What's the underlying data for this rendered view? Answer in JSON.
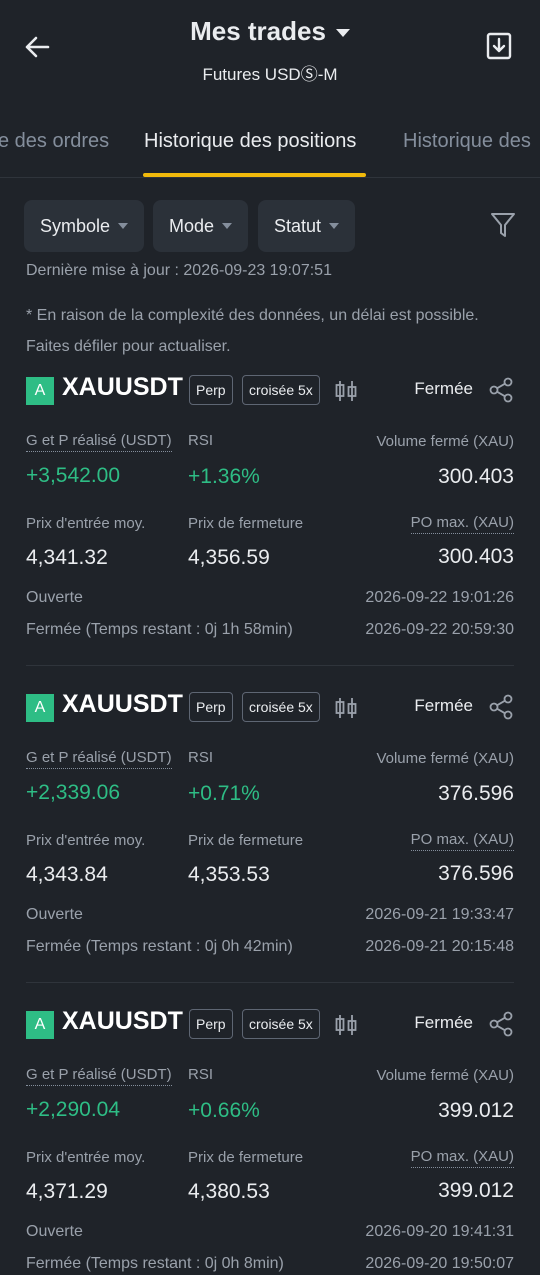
{
  "header": {
    "title": "Mes trades",
    "subtitle": "Futures USDⓈ-M"
  },
  "tabs": [
    {
      "label": "e des ordres"
    },
    {
      "label": "Historique des positions"
    },
    {
      "label": "Historique des"
    }
  ],
  "filters": {
    "symbol": "Symbole",
    "mode": "Mode",
    "status": "Statut"
  },
  "last_update": "Dernière mise à jour : 2026-09-23 19:07:51",
  "notice": "* En raison de la complexité des données, un délai est possible. Faites défiler pour actualiser.",
  "labels": {
    "pnl": "G et P réalisé (USDT)",
    "rsi": "RSI",
    "volume_closed": "Volume fermé (XAU)",
    "entry_price": "Prix d'entrée moy.",
    "close_price": "Prix de fermeture",
    "max_po": "PO max. (XAU)",
    "opened": "Ouverte"
  },
  "positions": [
    {
      "badge": "A",
      "symbol": "XAUUSDT",
      "type": "Perp",
      "margin": "croisée 5x",
      "status": "Fermée",
      "pnl": "+3,542.00",
      "rsi": "+1.36%",
      "volume": "300.403",
      "entry": "4,341.32",
      "close": "4,356.59",
      "max_po": "300.403",
      "opened_at": "2026-09-22 19:01:26",
      "closed_label": "Fermée (Temps restant : 0j 1h 58min)",
      "closed_at": "2026-09-22 20:59:30"
    },
    {
      "badge": "A",
      "symbol": "XAUUSDT",
      "type": "Perp",
      "margin": "croisée 5x",
      "status": "Fermée",
      "pnl": "+2,339.06",
      "rsi": "+0.71%",
      "volume": "376.596",
      "entry": "4,343.84",
      "close": "4,353.53",
      "max_po": "376.596",
      "opened_at": "2026-09-21 19:33:47",
      "closed_label": "Fermée (Temps restant : 0j 0h 42min)",
      "closed_at": "2026-09-21 20:15:48"
    },
    {
      "badge": "A",
      "symbol": "XAUUSDT",
      "type": "Perp",
      "margin": "croisée 5x",
      "status": "Fermée",
      "pnl": "+2,290.04",
      "rsi": "+0.66%",
      "volume": "399.012",
      "entry": "4,371.29",
      "close": "4,380.53",
      "max_po": "399.012",
      "opened_at": "2026-09-20 19:41:31",
      "closed_label": "Fermée (Temps restant : 0j 0h 8min)",
      "closed_at": "2026-09-20 19:50:07"
    }
  ],
  "colors": {
    "background": "#1f2329",
    "accent": "#f0b90b",
    "profit": "#2ebd85"
  }
}
